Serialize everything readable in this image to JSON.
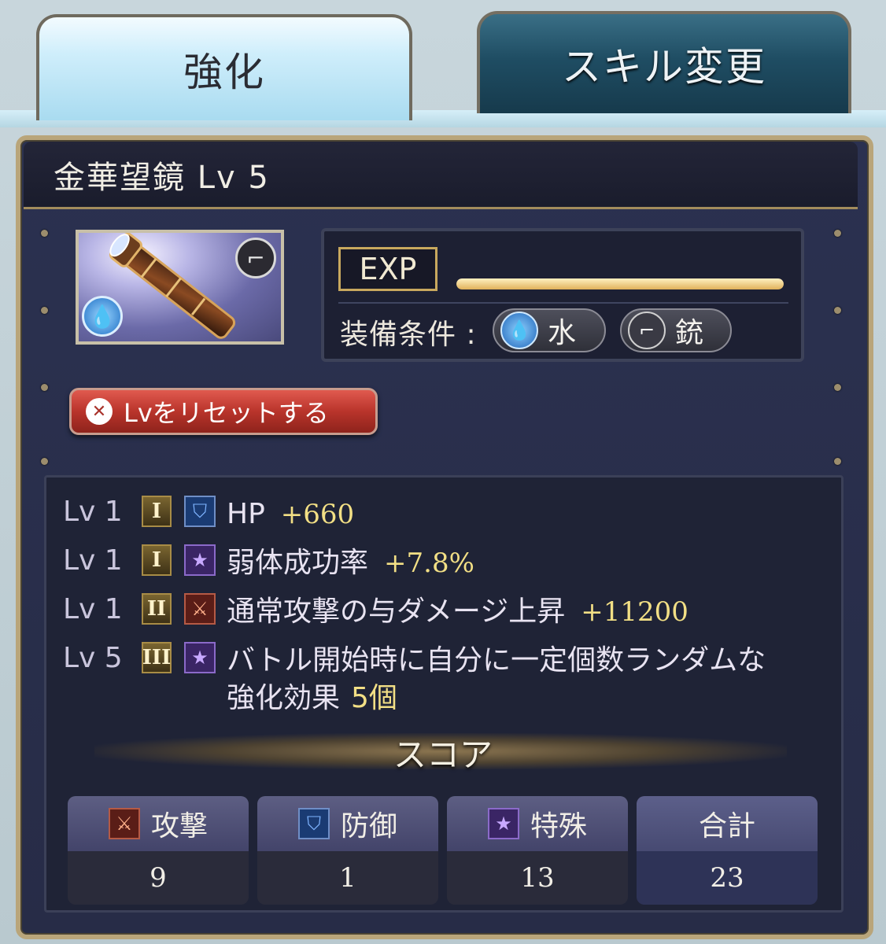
{
  "tabs": [
    {
      "label": "強化",
      "active": true
    },
    {
      "label": "スキル変更",
      "active": false
    }
  ],
  "weapon": {
    "title": "金華望鏡 Lv 5",
    "element_icon": "water-element-icon",
    "type_icon": "gun-icon"
  },
  "exp": {
    "label": "EXP",
    "progress": 1.0
  },
  "equip": {
    "label": "装備条件 :",
    "element": "水",
    "weapon_type": "銃"
  },
  "reset_button": "Lvをリセットする",
  "skills": [
    {
      "lv": "Lv 1",
      "tier": "I",
      "type": "def",
      "name": "HP",
      "value": "+660"
    },
    {
      "lv": "Lv 1",
      "tier": "I",
      "type": "spec",
      "name": "弱体成功率",
      "value": "+7.8%"
    },
    {
      "lv": "Lv 1",
      "tier": "II",
      "type": "atk",
      "name": "通常攻撃の与ダメージ上昇",
      "value": "+11200"
    },
    {
      "lv": "Lv 5",
      "tier": "III",
      "type": "spec",
      "name": "バトル開始時に自分に一定個数ランダムな",
      "name2": "強化効果",
      "value": "5個"
    }
  ],
  "score": {
    "title": "スコア",
    "cells": [
      {
        "label": "攻撃",
        "value": "9"
      },
      {
        "label": "防御",
        "value": "1"
      },
      {
        "label": "特殊",
        "value": "13"
      },
      {
        "label": "合計",
        "value": "23"
      }
    ]
  },
  "colors": {
    "accent_gold": "#f2df85",
    "panel": "#272c47",
    "reset_red": "#b9342b"
  }
}
